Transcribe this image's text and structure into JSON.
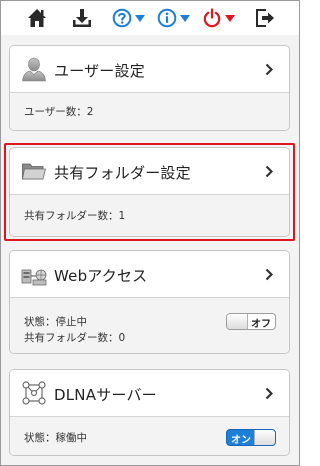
{
  "toolbar": {
    "items": [
      {
        "name": "home-icon"
      },
      {
        "name": "download-icon"
      },
      {
        "name": "help-icon"
      },
      {
        "name": "info-icon"
      },
      {
        "name": "power-icon"
      },
      {
        "name": "logout-icon"
      }
    ],
    "colors": {
      "icon": "#2a2a2a",
      "blue": "#1e7fd8",
      "red": "#e0161e"
    }
  },
  "cards": {
    "user": {
      "title": "ユーザー設定",
      "icon": "user-icon",
      "lines": [
        "ユーザー数：2"
      ]
    },
    "shared_folder": {
      "title": "共有フォルダー設定",
      "icon": "folder-icon",
      "lines": [
        "共有フォルダー数：1"
      ],
      "highlighted": true
    },
    "web_access": {
      "title": "Webアクセス",
      "icon": "web-access-icon",
      "lines": [
        "状態：停止中",
        "共有フォルダー数：0"
      ],
      "toggle": {
        "label": "オフ",
        "state": "off"
      }
    },
    "dlna": {
      "title": "DLNAサーバー",
      "icon": "dlna-icon",
      "lines": [
        "状態：稼働中"
      ],
      "toggle": {
        "label": "オン",
        "state": "on"
      }
    }
  }
}
